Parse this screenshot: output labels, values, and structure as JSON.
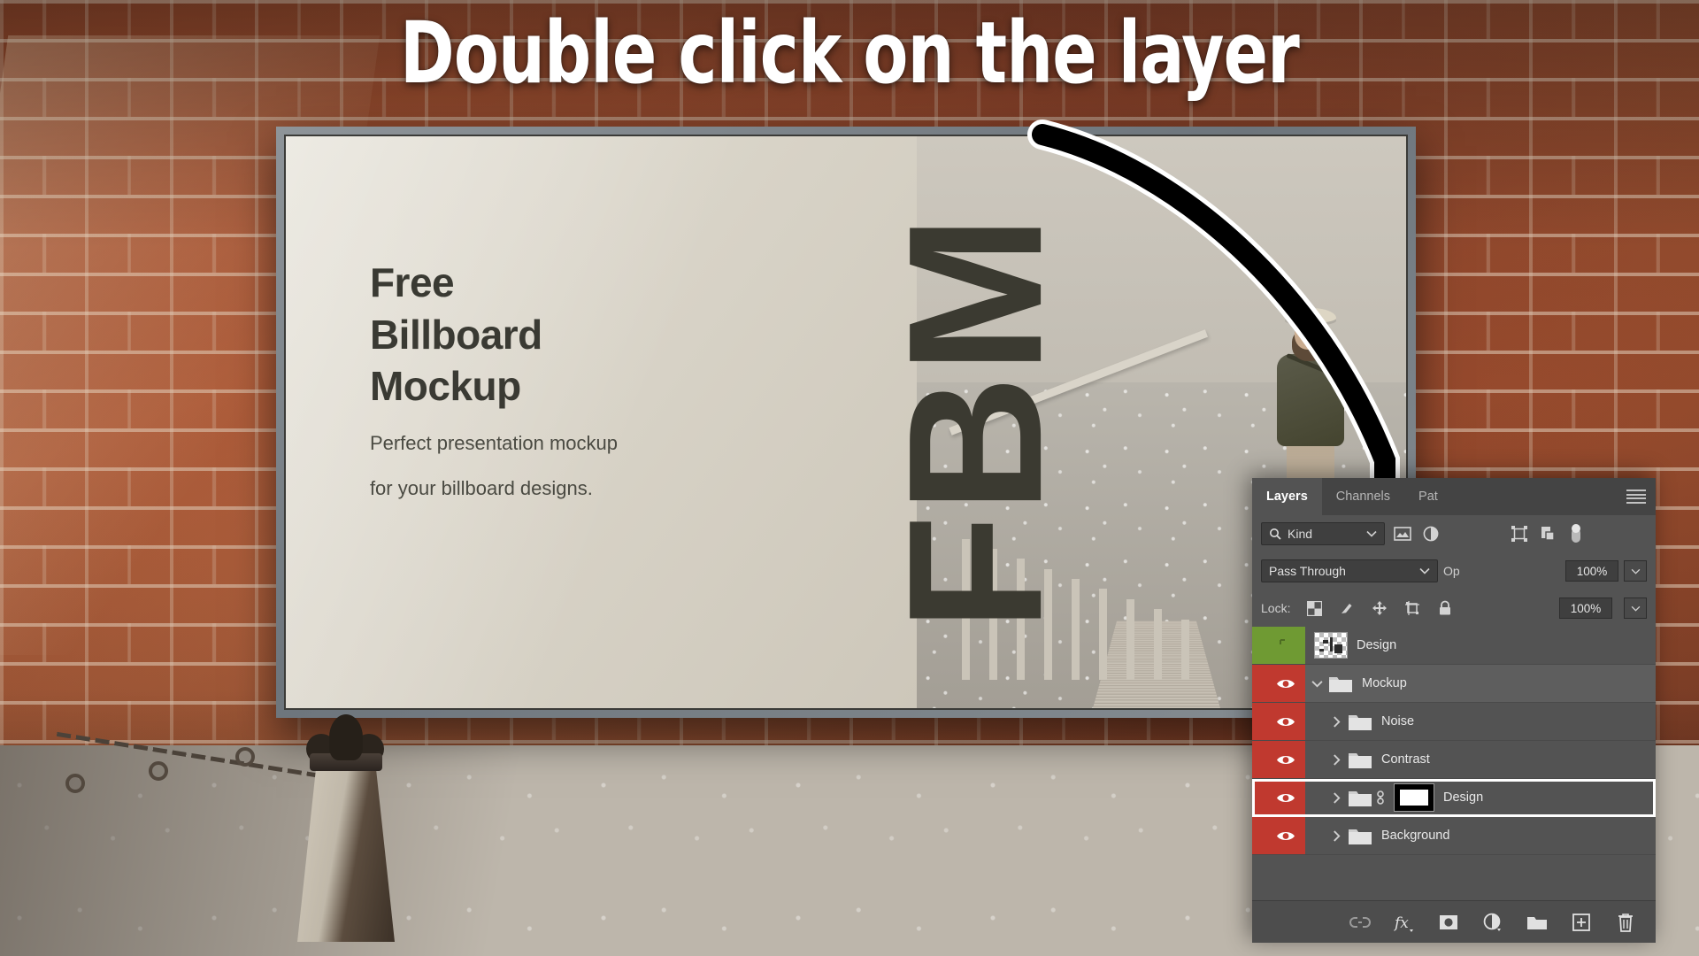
{
  "annotation": {
    "headline": "Double click on the layer",
    "arrow_icon": "curved-down-arrow"
  },
  "billboard": {
    "heading_line1": "Free",
    "heading_line2": "Billboard",
    "heading_line3": "Mockup",
    "subtext_line1": "Perfect presentation mockup",
    "subtext_line2": "for your billboard designs.",
    "monogram": "FBM"
  },
  "photoshop_panel": {
    "tabs": [
      {
        "label": "Layers",
        "active": true
      },
      {
        "label": "Channels",
        "active": false
      },
      {
        "label": "Pat",
        "active": false
      }
    ],
    "menu_icon": "hamburger-menu-icon",
    "filter": {
      "search_icon": "magnifier-icon",
      "kind_label": "Kind",
      "caret_icon": "chevron-down-icon",
      "filter_icons": [
        "pixel-layer-filter-icon",
        "adjustment-layer-filter-icon",
        "type-layer-filter-icon",
        "shape-layer-filter-icon",
        "smart-object-filter-icon",
        "filter-toggle-switch-icon"
      ]
    },
    "blend": {
      "mode": "Pass Through",
      "opacity_label": "Op",
      "opacity_value": "100%",
      "caret_icon": "chevron-down-icon"
    },
    "lock": {
      "label": "Lock:",
      "icons": [
        "lock-transparent-pixels-icon",
        "lock-image-pixels-icon",
        "lock-position-icon",
        "lock-artboard-nesting-icon",
        "lock-all-icon"
      ],
      "fill_value": "100%"
    },
    "layers": [
      {
        "name": "Design",
        "color_label": "#6f9a33",
        "visible": false,
        "thumb": "checkerboard-thumbnail",
        "type": "layer",
        "indent": 0,
        "expanded": null,
        "selected": false,
        "highlighted": false
      },
      {
        "name": "Mockup",
        "color_label": "#c0392f",
        "visible": true,
        "thumb": "folder-icon",
        "type": "group",
        "indent": 0,
        "expanded": true,
        "selected": true,
        "highlighted": false
      },
      {
        "name": "Noise",
        "color_label": "#c0392f",
        "visible": true,
        "thumb": "folder-icon",
        "type": "group",
        "indent": 1,
        "expanded": false,
        "selected": false,
        "highlighted": false
      },
      {
        "name": "Contrast",
        "color_label": "#c0392f",
        "visible": true,
        "thumb": "folder-icon",
        "type": "group",
        "indent": 1,
        "expanded": false,
        "selected": false,
        "highlighted": false
      },
      {
        "name": "Design",
        "color_label": "#c0392f",
        "visible": true,
        "thumb": "folder-icon",
        "type": "group",
        "indent": 1,
        "expanded": false,
        "selected": false,
        "highlighted": true,
        "has_mask": true,
        "mask_link_icon": "link-icon"
      },
      {
        "name": "Background",
        "color_label": "#c0392f",
        "visible": true,
        "thumb": "folder-icon",
        "type": "group",
        "indent": 1,
        "expanded": false,
        "selected": false,
        "highlighted": false
      }
    ],
    "bottom_bar_icons": [
      "link-layers-icon",
      "layer-style-fx-icon",
      "add-layer-mask-icon",
      "new-adjustment-layer-icon",
      "new-group-icon",
      "new-layer-icon",
      "delete-layer-icon"
    ],
    "colors": {
      "panel_bg": "#535353",
      "tab_bg": "#444444",
      "red_label": "#c0392f",
      "green_label": "#6f9a33",
      "selected_row": "#5e5e5e",
      "highlight_outline": "#ffffff"
    }
  }
}
